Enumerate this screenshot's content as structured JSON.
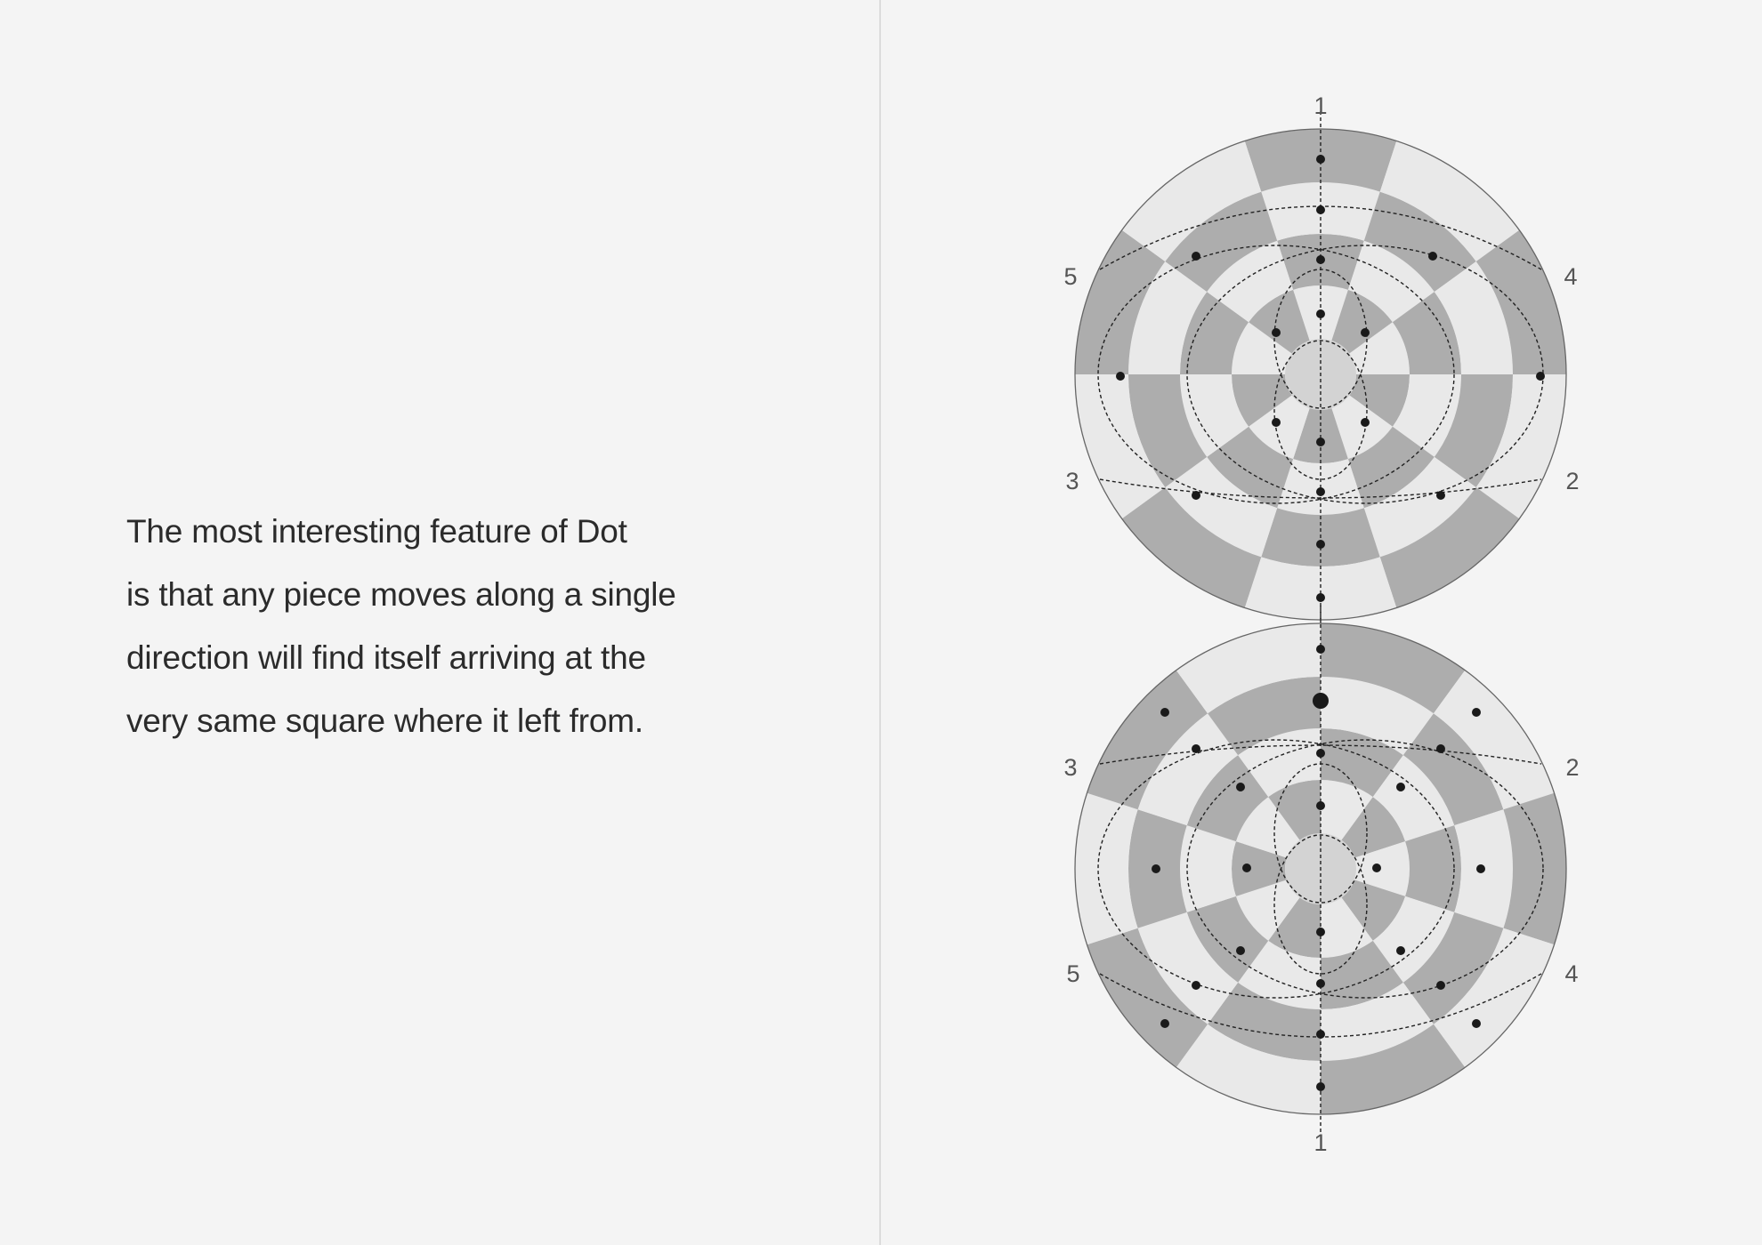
{
  "text": {
    "lines": [
      "The most interesting feature of Dot",
      "is that any piece moves along a single",
      "direction will find itself arriving at the",
      "very same square where it left from."
    ]
  },
  "diagram": {
    "top_board": {
      "labels": {
        "top": "1",
        "upper_left": "5",
        "upper_right": "4",
        "lower_left": "3",
        "lower_right": "2"
      }
    },
    "bottom_board": {
      "labels": {
        "bottom": "1",
        "upper_left": "3",
        "upper_right": "2",
        "lower_left": "5",
        "lower_right": "4"
      }
    },
    "colors": {
      "dark": "#adadad",
      "light": "#e9e9e9",
      "center": "#d3d3d3",
      "dot": "#1a1a1a",
      "outline": "#666666"
    }
  }
}
